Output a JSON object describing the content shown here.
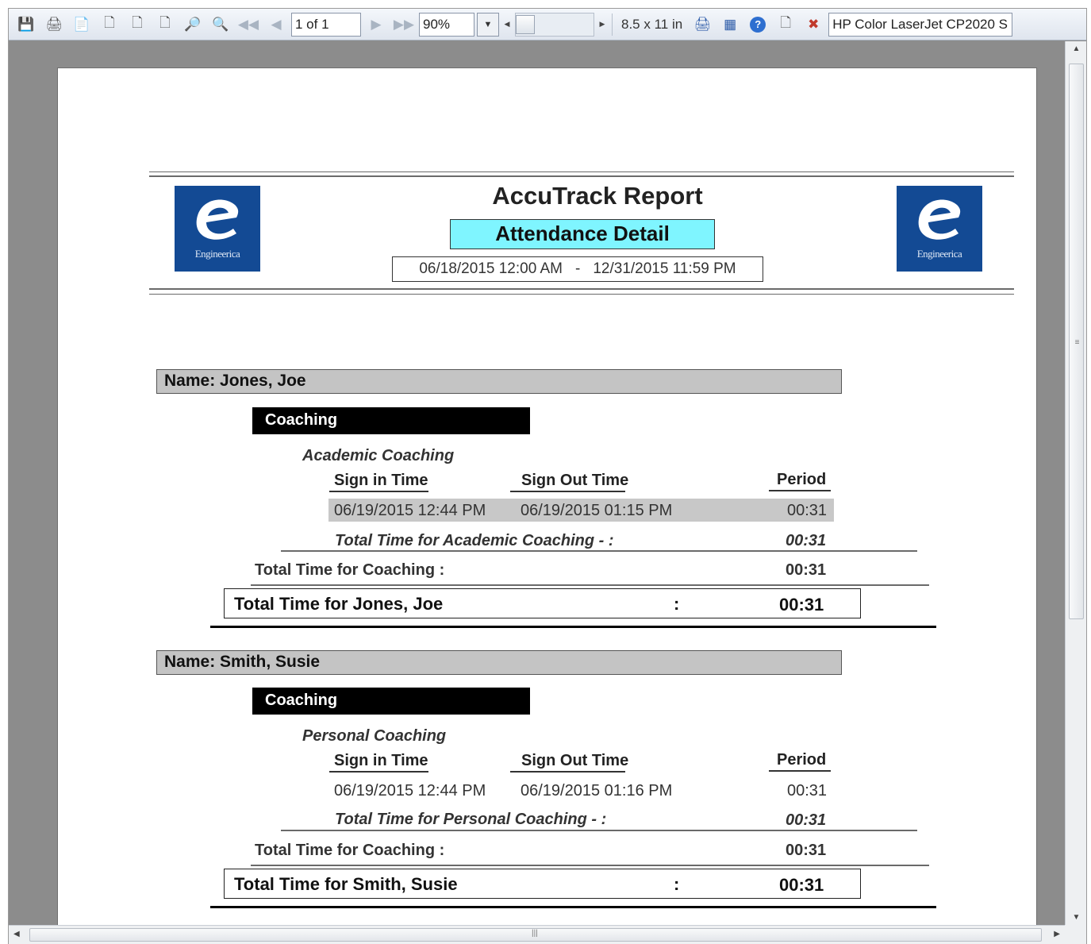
{
  "toolbar": {
    "page_indicator": "1 of 1",
    "zoom": "90%",
    "paper_size": "8.5 x 11 in",
    "printer": "HP Color LaserJet CP2020 S"
  },
  "report": {
    "title": "AccuTrack Report",
    "subtitle": "Attendance Detail",
    "date_start": "06/18/2015 12:00 AM",
    "date_sep": "-",
    "date_end": "12/31/2015 11:59 PM",
    "logo_text": "Engineerica",
    "logo_color": "#134a94",
    "subtitle_bg": "#7ff5ff",
    "columns": {
      "sign_in": "Sign in Time",
      "sign_out": "Sign Out Time",
      "period": "Period"
    },
    "people": [
      {
        "name_label": "Name: Jones, Joe",
        "category": "Coaching",
        "subcategory": "Academic Coaching",
        "row": {
          "sign_in": "06/19/2015 12:44 PM",
          "sign_out": "06/19/2015 01:15 PM",
          "period": "00:31"
        },
        "sub_total_label": "Total Time for Academic Coaching - :",
        "sub_total_value": "00:31",
        "cat_total_label": "Total Time for Coaching :",
        "cat_total_value": "00:31",
        "person_total_label": "Total Time for Jones, Joe",
        "person_total_colon": ":",
        "person_total_value": "00:31"
      },
      {
        "name_label": "Name: Smith, Susie",
        "category": "Coaching",
        "subcategory": "Personal Coaching",
        "row": {
          "sign_in": "06/19/2015 12:44 PM",
          "sign_out": "06/19/2015 01:16 PM",
          "period": "00:31"
        },
        "sub_total_label": "Total Time for Personal Coaching - :",
        "sub_total_value": "00:31",
        "cat_total_label": "Total Time for Coaching :",
        "cat_total_value": "00:31",
        "person_total_label": "Total Time for Smith, Susie",
        "person_total_colon": ":",
        "person_total_value": "00:31"
      }
    ]
  }
}
